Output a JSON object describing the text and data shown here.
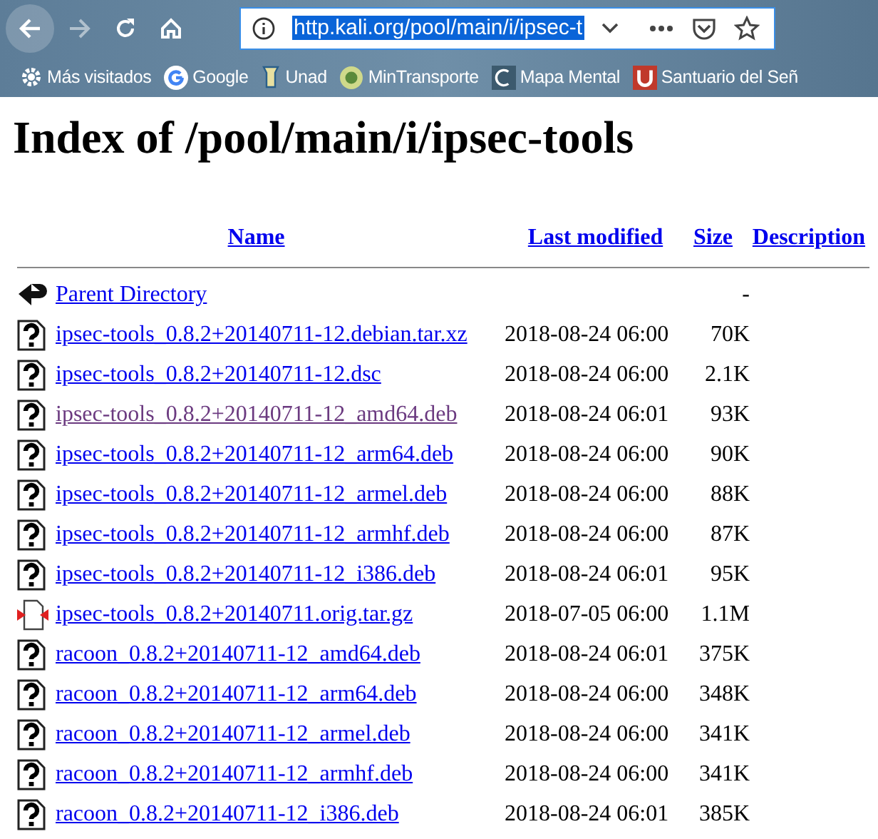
{
  "browser": {
    "url": "http.kali.org/pool/main/i/ipsec-t",
    "url_selected": true,
    "bookmarks": [
      {
        "label": "Más visitados"
      },
      {
        "label": "Google"
      },
      {
        "label": "Unad"
      },
      {
        "label": "MinTransporte"
      },
      {
        "label": "Mapa Mental"
      },
      {
        "label": "Santuario del Señ"
      }
    ]
  },
  "page": {
    "title": "Index of /pool/main/i/ipsec-tools",
    "columns": [
      "Name",
      "Last modified",
      "Size",
      "Description"
    ],
    "rows": [
      {
        "kind": "parent",
        "name": "Parent Directory",
        "modified": "",
        "size": "-",
        "visited": false
      },
      {
        "kind": "unknown",
        "name": "ipsec-tools_0.8.2+20140711-12.debian.tar.xz",
        "modified": "2018-08-24 06:00",
        "size": "70K",
        "visited": false
      },
      {
        "kind": "unknown",
        "name": "ipsec-tools_0.8.2+20140711-12.dsc",
        "modified": "2018-08-24 06:00",
        "size": "2.1K",
        "visited": false
      },
      {
        "kind": "unknown",
        "name": "ipsec-tools_0.8.2+20140711-12_amd64.deb",
        "modified": "2018-08-24 06:01",
        "size": "93K",
        "visited": true
      },
      {
        "kind": "unknown",
        "name": "ipsec-tools_0.8.2+20140711-12_arm64.deb",
        "modified": "2018-08-24 06:00",
        "size": "90K",
        "visited": false
      },
      {
        "kind": "unknown",
        "name": "ipsec-tools_0.8.2+20140711-12_armel.deb",
        "modified": "2018-08-24 06:00",
        "size": "88K",
        "visited": false
      },
      {
        "kind": "unknown",
        "name": "ipsec-tools_0.8.2+20140711-12_armhf.deb",
        "modified": "2018-08-24 06:00",
        "size": "87K",
        "visited": false
      },
      {
        "kind": "unknown",
        "name": "ipsec-tools_0.8.2+20140711-12_i386.deb",
        "modified": "2018-08-24 06:01",
        "size": "95K",
        "visited": false
      },
      {
        "kind": "compressed",
        "name": "ipsec-tools_0.8.2+20140711.orig.tar.gz",
        "modified": "2018-07-05 06:00",
        "size": "1.1M",
        "visited": false
      },
      {
        "kind": "unknown",
        "name": "racoon_0.8.2+20140711-12_amd64.deb",
        "modified": "2018-08-24 06:01",
        "size": "375K",
        "visited": false
      },
      {
        "kind": "unknown",
        "name": "racoon_0.8.2+20140711-12_arm64.deb",
        "modified": "2018-08-24 06:00",
        "size": "348K",
        "visited": false
      },
      {
        "kind": "unknown",
        "name": "racoon_0.8.2+20140711-12_armel.deb",
        "modified": "2018-08-24 06:00",
        "size": "341K",
        "visited": false
      },
      {
        "kind": "unknown",
        "name": "racoon_0.8.2+20140711-12_armhf.deb",
        "modified": "2018-08-24 06:00",
        "size": "341K",
        "visited": false
      },
      {
        "kind": "unknown",
        "name": "racoon_0.8.2+20140711-12_i386.deb",
        "modified": "2018-08-24 06:01",
        "size": "385K",
        "visited": false
      }
    ]
  }
}
